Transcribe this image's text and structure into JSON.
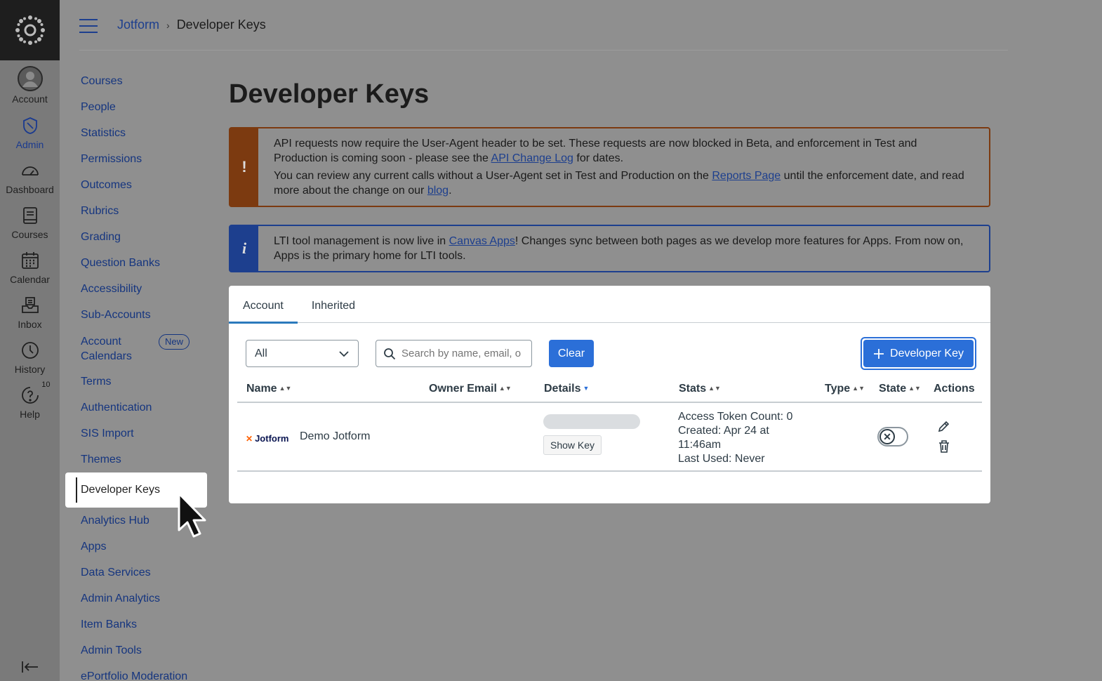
{
  "rail": {
    "items": [
      {
        "label": "Account",
        "icon": "account-icon"
      },
      {
        "label": "Admin",
        "icon": "admin-icon"
      },
      {
        "label": "Dashboard",
        "icon": "dashboard-icon"
      },
      {
        "label": "Courses",
        "icon": "courses-icon"
      },
      {
        "label": "Calendar",
        "icon": "calendar-icon"
      },
      {
        "label": "Inbox",
        "icon": "inbox-icon"
      },
      {
        "label": "History",
        "icon": "history-icon"
      },
      {
        "label": "Help",
        "icon": "help-icon",
        "badge": "10"
      }
    ]
  },
  "header": {
    "breadcrumb_root": "Jotform",
    "breadcrumb_separator": "›",
    "breadcrumb_current": "Developer Keys"
  },
  "subnav": {
    "items": [
      "Courses",
      "People",
      "Statistics",
      "Permissions",
      "Outcomes",
      "Rubrics",
      "Grading",
      "Question Banks",
      "Accessibility",
      "Sub-Accounts"
    ],
    "account_calendars_line1": "Account",
    "account_calendars_line2": "Calendars",
    "new_badge": "New",
    "items_after": [
      "Terms",
      "Authentication",
      "SIS Import",
      "Themes"
    ],
    "active": "Developer Keys",
    "items_tail": [
      "Analytics Hub",
      "Apps",
      "Data Services",
      "Admin Analytics",
      "Item Banks",
      "Admin Tools",
      "ePortfolio Moderation"
    ]
  },
  "page": {
    "title": "Developer Keys"
  },
  "warning_alert": {
    "icon": "!",
    "p1_a": "API requests now require the User-Agent header to be set. These requests are now blocked in Beta, and enforcement in Test and Production is coming soon - please see the ",
    "p1_link": "API Change Log",
    "p1_b": " for dates.",
    "p2_a": "You can review any current calls without a User-Agent set in Test and Production on the ",
    "p2_link": "Reports Page",
    "p2_b": " until the enforcement date, and read more about the change on our ",
    "p2_link2": "blog",
    "p2_c": "."
  },
  "info_alert": {
    "icon": "i",
    "a": "LTI tool management is now live in ",
    "link": "Canvas Apps",
    "b": "! Changes sync between both pages as we develop more features for Apps. From now on, Apps is the primary home for LTI tools."
  },
  "tabs": [
    "Account",
    "Inherited"
  ],
  "toolbar": {
    "filter_value": "All",
    "search_placeholder": "Search by name, email, or ID",
    "clear_label": "Clear",
    "add_label": "Developer Key"
  },
  "table": {
    "columns": [
      "Name",
      "Owner Email",
      "Details",
      "Stats",
      "Type",
      "State",
      "Actions"
    ],
    "rows": [
      {
        "logo_text": "Jotform",
        "name": "Demo Jotform",
        "owner_email": "",
        "show_key_label": "Show Key",
        "stats_line1": "Access Token Count: 0",
        "stats_line2": "Created: Apr 24 at",
        "stats_line3": "11:46am",
        "stats_line4": "Last Used: Never",
        "state": "off"
      }
    ]
  },
  "colors": {
    "brand_blue": "#2b6fd8",
    "warning": "#7c3a10",
    "info": "#1d3f8e"
  }
}
